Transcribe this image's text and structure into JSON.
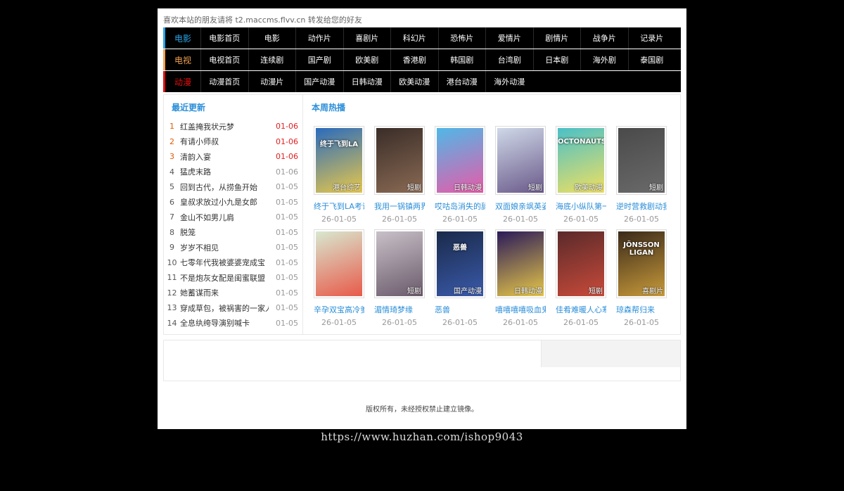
{
  "welcome": "喜欢本站的朋友请将 t2.maccms.flvv.cn 转发给您的好友",
  "nav": [
    {
      "category": "电影",
      "items": [
        "电影首页",
        "电影",
        "动作片",
        "喜剧片",
        "科幻片",
        "恐怖片",
        "爱情片",
        "剧情片",
        "战争片",
        "记录片"
      ]
    },
    {
      "category": "电视",
      "items": [
        "电视首页",
        "连续剧",
        "国产剧",
        "欧美剧",
        "香港剧",
        "韩国剧",
        "台湾剧",
        "日本剧",
        "海外剧",
        "泰国剧"
      ]
    },
    {
      "category": "动漫",
      "items": [
        "动漫首页",
        "动漫片",
        "国产动漫",
        "日韩动漫",
        "欧美动漫",
        "港台动漫",
        "海外动漫"
      ]
    }
  ],
  "latest": {
    "title": "最近更新",
    "items": [
      {
        "num": "1",
        "title": "红盖掩我状元梦",
        "date": "01-06"
      },
      {
        "num": "2",
        "title": "有请小师叔",
        "date": "01-06"
      },
      {
        "num": "3",
        "title": "清韵入宴",
        "date": "01-06"
      },
      {
        "num": "4",
        "title": "猛虎末路",
        "date": "01-06"
      },
      {
        "num": "5",
        "title": "回到古代，从捞鱼开始",
        "date": "01-05"
      },
      {
        "num": "6",
        "title": "皇叔求放过小九是女郎",
        "date": "01-05"
      },
      {
        "num": "7",
        "title": "金山不如男儿肩",
        "date": "01-05"
      },
      {
        "num": "8",
        "title": "脱笼",
        "date": "01-05"
      },
      {
        "num": "9",
        "title": "岁岁不相见",
        "date": "01-05"
      },
      {
        "num": "10",
        "title": "七零年代我被婆婆宠成宝",
        "date": "01-05"
      },
      {
        "num": "11",
        "title": "不是炮灰女配是闺蜜联盟",
        "date": "01-05"
      },
      {
        "num": "12",
        "title": "她蓄谋而来",
        "date": "01-05"
      },
      {
        "num": "13",
        "title": "穿成草包，被祸害的一家人都",
        "date": "01-05"
      },
      {
        "num": "14",
        "title": "全息纨绔导演别喊卡",
        "date": "01-05"
      }
    ]
  },
  "hot": {
    "title": "本周热播",
    "items": [
      {
        "name": "终于飞到LA考语",
        "date": "26-01-05",
        "tag": "港台综艺",
        "colors": [
          "#2a6bbd",
          "#e8c84a"
        ],
        "poster_text": "终于飞到LA"
      },
      {
        "name": "我用一锅镇两界",
        "date": "26-01-05",
        "tag": "短剧",
        "colors": [
          "#3a2d28",
          "#8a6a54"
        ],
        "poster_text": ""
      },
      {
        "name": "哎咕岛消失的舔甜",
        "date": "26-01-05",
        "tag": "日韩动漫",
        "colors": [
          "#4fb8e8",
          "#e85aa8"
        ],
        "poster_text": ""
      },
      {
        "name": "双面娘亲飒英姿",
        "date": "26-01-05",
        "tag": "短剧",
        "colors": [
          "#cfd8e8",
          "#6a5a8a"
        ],
        "poster_text": ""
      },
      {
        "name": "海底小纵队第一季",
        "date": "26-01-05",
        "tag": "欧美动漫",
        "colors": [
          "#4ac0c8",
          "#f0e060"
        ],
        "poster_text": "OCTONAUTS"
      },
      {
        "name": "逆时营救剧动我乡",
        "date": "26-01-05",
        "tag": "短剧",
        "colors": [
          "#4a4a4a",
          "#6a6a6a"
        ],
        "poster_text": ""
      },
      {
        "name": "辛孕双宝高冷爹地",
        "date": "26-01-05",
        "tag": "",
        "colors": [
          "#d8e8d0",
          "#e85a4a"
        ],
        "poster_text": ""
      },
      {
        "name": "湄情琦梦缘",
        "date": "26-01-05",
        "tag": "短剧",
        "colors": [
          "#c8c0c8",
          "#6a5a6a"
        ],
        "poster_text": ""
      },
      {
        "name": "恶兽",
        "date": "26-01-05",
        "tag": "国产动漫",
        "colors": [
          "#1a2a4a",
          "#3a5aaa"
        ],
        "poster_text": "恶兽"
      },
      {
        "name": "嘻嘻嘻嘻吸血鬼",
        "date": "26-01-05",
        "tag": "日韩动漫",
        "colors": [
          "#2a1a5a",
          "#e8c848"
        ],
        "poster_text": ""
      },
      {
        "name": "佳肴难暖人心寒",
        "date": "26-01-05",
        "tag": "短剧",
        "colors": [
          "#5a2a2a",
          "#c84a3a"
        ],
        "poster_text": ""
      },
      {
        "name": "琼森帮归来",
        "date": "26-01-05",
        "tag": "喜剧片",
        "colors": [
          "#3a2a1a",
          "#c89a3a"
        ],
        "poster_text": "JÖNSSON LIGAN"
      }
    ]
  },
  "copyright": "版权所有，未经授权禁止建立镜像。",
  "watermark": "https://www.huzhan.com/ishop9043"
}
